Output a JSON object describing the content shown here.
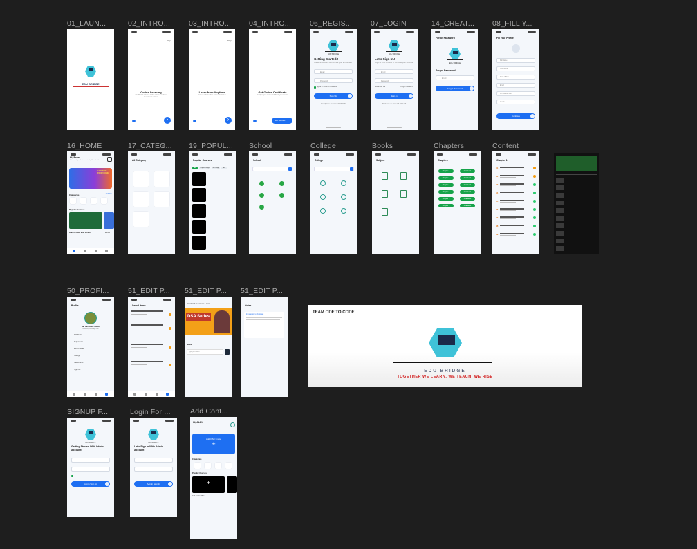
{
  "frames": {
    "f01": {
      "label": "01_LAUN...",
      "brand": "EDU BRIDGE"
    },
    "f02": {
      "label": "02_INTRO...",
      "skip": "Skip",
      "title": "Online Learning",
      "desc": "We Provide Classes Online Classes and Pre Recorded Lectures!"
    },
    "f03": {
      "label": "03_INTRO...",
      "skip": "Skip",
      "title": "Learn from Anytime",
      "desc": "Booked or Same the Lectures for Future"
    },
    "f04": {
      "label": "04_INTRO...",
      "title": "Get Online Certificate",
      "desc": "Analyse your scores and Track your results",
      "cta": "Get Started"
    },
    "f06": {
      "label": "06_REGIS...",
      "brand": "EDU BRIDGE",
      "title": "Getting Started.!",
      "desc": "Create an Account to Continue your all Courses",
      "email": "Email",
      "password": "Password",
      "terms": "Agree to Terms & Conditions",
      "cta": "Sign Up",
      "alt": "Already have an Account? SIGN IN"
    },
    "f07": {
      "label": "07_LOGIN",
      "brand": "EDU BRIDGE",
      "title": "Let's Sign In.!",
      "desc": "Login to Your Account to Continue your Courses",
      "email": "Email",
      "password": "Password",
      "remember": "Remember Me",
      "forgot": "Forgot Password?",
      "cta": "Sign In",
      "alt": "Don't have an Account? SIGN UP"
    },
    "f14": {
      "label": "14_CREAT...",
      "back": "Forgot Password",
      "brand": "EDU BRIDGE",
      "title": "Forgot Password!",
      "email": "Email",
      "cta": "Forgot Password"
    },
    "f08": {
      "label": "08_FILL Y...",
      "title": "Fill Your Profile",
      "f1": "Full Name",
      "f2": "Nick Name",
      "f3": "Date of Birth",
      "f4": "Email",
      "f5": "+1 724-848-1225",
      "f6": "Gender",
      "cta": "Continue"
    },
    "f16": {
      "label": "16_HOME",
      "greet": "Hi, Brew!",
      "greet_sub": "What would you like to learn today? Search Below.",
      "banner": "LEARNING FROM HOME",
      "cat": "Categories",
      "see": "SEE ALL",
      "pop": "Popular Courses",
      "course1": "Learn to Code from Scratch",
      "course2": "AUTO"
    },
    "f17": {
      "label": "17_CATEG...",
      "title": "All Category"
    },
    "f19": {
      "label": "19_POPUL...",
      "title": "Popular Courses",
      "tab1": "All",
      "tab2": "Graphic Design",
      "tab3": "3D Design",
      "tab4": "Arts"
    },
    "school": {
      "label": "School",
      "title": "School"
    },
    "college": {
      "label": "College",
      "title": "College"
    },
    "books": {
      "label": "Books",
      "title": "Subject"
    },
    "chapters": {
      "label": "Chapters",
      "title": "Chapters",
      "chip": "Chapter 1"
    },
    "content": {
      "label": "Content",
      "title": "Chapter 1",
      "r1": "Video",
      "r2": "Note"
    },
    "f50": {
      "label": "50_PROFI...",
      "title": "Profile",
      "name": "Mr. Sai Kumar Naidu",
      "email": "saikumar@edubridge.com",
      "m1": "Edit Profile",
      "m2": "Help Center",
      "m3": "Invite Friends",
      "m4": "Settings",
      "m5": "Saved Items",
      "m6": "Sign Out"
    },
    "f51a": {
      "label": "51_EDIT P...",
      "title": "Saved Items"
    },
    "f51b": {
      "label": "51_EDIT P...",
      "title": "Flowchart & Pseudocode + Install...",
      "poster": "DSA Series",
      "notes": "Notes",
      "placeholder": "Type your notes"
    },
    "f51c": {
      "label": "51_EDIT P...",
      "title": "Notes",
      "heading": "Introduction to Flowchart"
    },
    "team": {
      "label": "TEAM ODE TO CODE",
      "brand": "EDU BRIDGE",
      "tagline": "TOGETHER WE LEARN, WE TEACH, WE RISE"
    },
    "signup": {
      "label": "SIGNUP F...",
      "brand": "EDU BRIDGE",
      "title": "Getting Started With Admin Account!",
      "cta": "Admin Sign Up"
    },
    "loginf": {
      "label": "Login For ...",
      "brand": "EDU BRIDGE",
      "title": "Let's Sign In With Admin Account",
      "cta": "Admin Sign In"
    },
    "addc": {
      "label": "Add Cont...",
      "greet": "Hi, ALEX",
      "banner": "Add Offer Image",
      "cat": "Categories",
      "pop": "Popular Courses",
      "add": "Add Course Title"
    }
  }
}
